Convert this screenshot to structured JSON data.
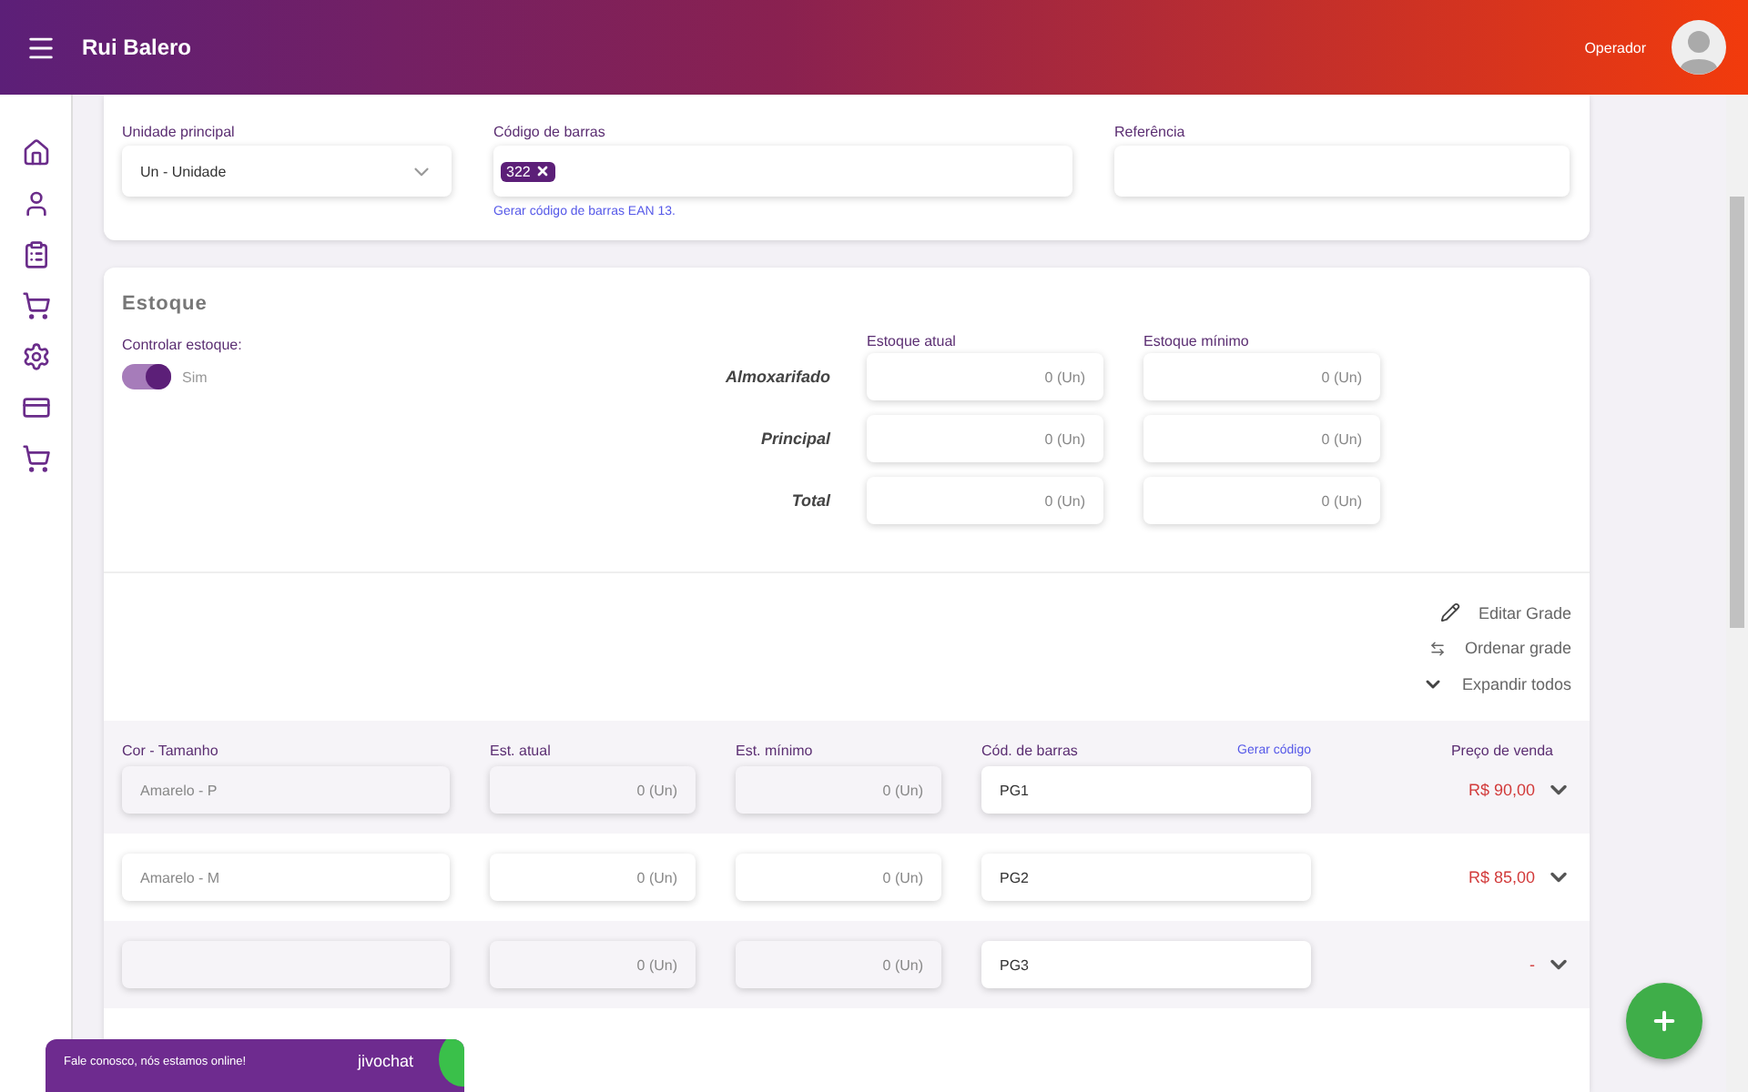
{
  "header": {
    "title": "Rui Balero",
    "user": "Operador"
  },
  "product": {
    "fields": [
      {
        "kind": "select",
        "label": "Unidade principal",
        "value": "Un - Unidade"
      },
      {
        "kind": "tags",
        "label": "Código de barras",
        "tags": [
          "322"
        ],
        "link": "Gerar código de barras EAN 13."
      },
      {
        "kind": "text",
        "label": "Referência"
      }
    ]
  },
  "stock": {
    "title": "Estoque",
    "control": {
      "label": "Controlar estoque:",
      "on": true,
      "text": "Sim"
    },
    "columns": [
      "Estoque atual",
      "Estoque mínimo"
    ],
    "rows": [
      {
        "label": "Almoxarifado",
        "values": [
          "0 (Un)",
          "0 (Un)"
        ]
      },
      {
        "label": "Principal",
        "values": [
          "0 (Un)",
          "0 (Un)"
        ]
      },
      {
        "label": "Total",
        "values": [
          "0 (Un)",
          "0 (Un)"
        ]
      }
    ]
  },
  "grade_actions": [
    {
      "kind": "edit",
      "label": "Editar Grade"
    },
    {
      "kind": "sort",
      "label": "Ordenar grade"
    },
    {
      "kind": "expand",
      "label": "Expandir todos"
    }
  ],
  "grade": {
    "columns": [
      "Cor - Tamanho",
      "Est. atual",
      "Est. mínimo",
      "Cód. de barras",
      "Preço de venda"
    ],
    "generate_link": "Gerar código",
    "rows": [
      {
        "variant": "Amarelo - P",
        "stock": "0 (Un)",
        "minimum": "0 (Un)",
        "barcode": "PG1",
        "price": "R$ 90,00"
      },
      {
        "variant": "Amarelo - M",
        "stock": "0 (Un)",
        "minimum": "0 (Un)",
        "barcode": "PG2",
        "price": "R$ 85,00"
      },
      {
        "stock": "0 (Un)",
        "minimum": "0 (Un)",
        "barcode": "PG3",
        "price": "-"
      }
    ]
  },
  "chat": {
    "message": "Fale conosco, nós estamos online!",
    "brand": "jivochat"
  }
}
